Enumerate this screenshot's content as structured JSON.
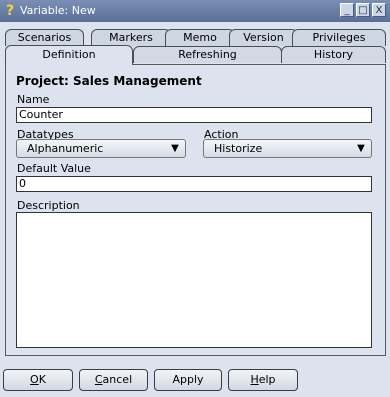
{
  "window": {
    "title": "Variable: New",
    "controls": {
      "minimize": "_",
      "maximize": "□",
      "close": "X"
    }
  },
  "tabs": {
    "row1": [
      "Scenarios",
      "Markers",
      "Memo",
      "Version",
      "Privileges"
    ],
    "row2": [
      "Definition",
      "Refreshing",
      "History"
    ],
    "active": "Definition"
  },
  "form": {
    "project_label": "Project: Sales Management",
    "name_label": "Name",
    "name_value": "Counter",
    "datatypes_label": "Datatypes",
    "datatypes_value": "Alphanumeric",
    "action_label": "Action",
    "action_value": "Historize",
    "default_label": "Default Value",
    "default_value": "0",
    "description_label": "Description",
    "description_value": ""
  },
  "buttons": {
    "ok": {
      "first": "O",
      "rest": "K"
    },
    "cancel": {
      "first": "C",
      "rest": "ancel"
    },
    "apply": "Apply",
    "help": {
      "first": "H",
      "rest": "elp"
    }
  }
}
